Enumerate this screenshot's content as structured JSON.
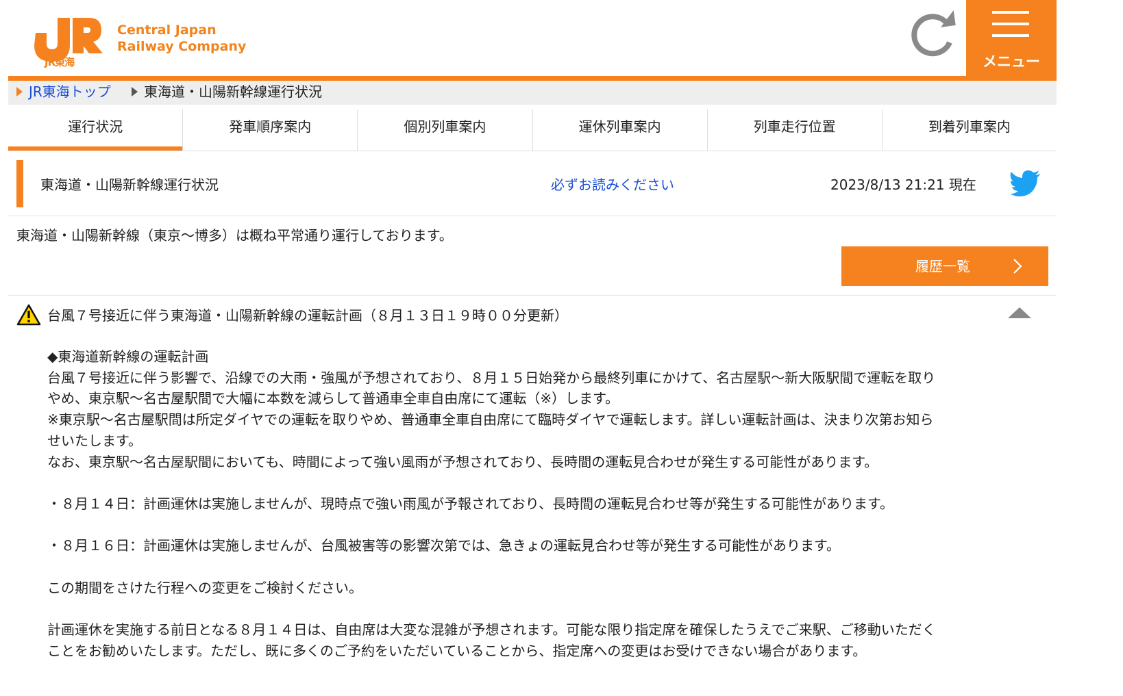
{
  "header": {
    "logo_text": "JR",
    "logo_sub": "JR東海",
    "company_line1": "Central Japan",
    "company_line2": "Railway Company",
    "menu_label": "メニュー",
    "brand_color": "#f5821f",
    "link_color": "#1a4fd6"
  },
  "breadcrumb": {
    "home": "JR東海トップ",
    "current": "東海道・山陽新幹線運行状況"
  },
  "tabs": [
    {
      "label": "運行状況",
      "active": true
    },
    {
      "label": "発車順序案内"
    },
    {
      "label": "個別列車案内"
    },
    {
      "label": "運休列車案内"
    },
    {
      "label": "列車走行位置"
    },
    {
      "label": "到着列車案内"
    }
  ],
  "status": {
    "title": "東海道・山陽新幹線運行状況",
    "must_read": "必ずお読みください",
    "timestamp": "2023/8/13 21:21 現在"
  },
  "summary": "東海道・山陽新幹線（東京～博多）は概ね平常通り運行しております。",
  "history_button": "履歴一覧",
  "notice": {
    "title": "台風７号接近に伴う東海道・山陽新幹線の運転計画（８月１３日１９時００分更新）",
    "lines": [
      "◆東海道新幹線の運転計画",
      "台風７号接近に伴う影響で、沿線での大雨・強風が予想されており、８月１５日始発から最終列車にかけて、名古屋駅～新大阪駅間で運転を取り",
      "やめ、東京駅～名古屋駅間で大幅に本数を減らして普通車全車自由席にて運転（※）します。",
      "※東京駅～名古屋駅間は所定ダイヤでの運転を取りやめ、普通車全車自由席にて臨時ダイヤで運転します。詳しい運転計画は、決まり次第お知ら",
      "せいたします。",
      "なお、東京駅～名古屋駅間においても、時間によって強い風雨が予想されており、長時間の運転見合わせが発生する可能性があります。",
      "",
      "・８月１４日：計画運休は実施しませんが、現時点で強い雨風が予報されており、長時間の運転見合わせ等が発生する可能性があります。",
      "",
      "・８月１６日：計画運休は実施しませんが、台風被害等の影響次第では、急きょの運転見合わせ等が発生する可能性があります。",
      "",
      "この期間をさけた行程への変更をご検討ください。",
      "",
      "計画運休を実施する前日となる８月１４日は、自由席は大変な混雑が予想されます。可能な限り指定席を確保したうえでご来駅、ご移動いただく",
      "ことをお勧めいたします。ただし、既に多くのご予約をいただいていることから、指定席への変更はお受けできない場合があります。"
    ]
  }
}
